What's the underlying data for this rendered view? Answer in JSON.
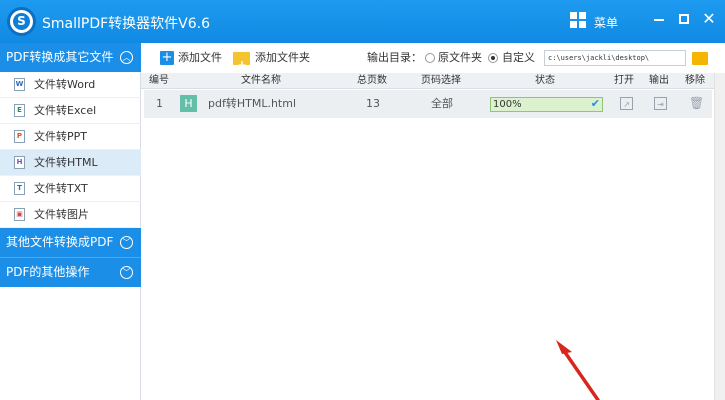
{
  "app": {
    "title": "SmallPDF转换器软件V6.6",
    "logo_letter": "S",
    "menu_label": "菜单"
  },
  "sidebar": {
    "groups": [
      {
        "label": "PDF转换成其它文件",
        "expanded": true,
        "items": [
          {
            "label": "文件转Word",
            "icon": "W"
          },
          {
            "label": "文件转Excel",
            "icon": "E"
          },
          {
            "label": "文件转PPT",
            "icon": "P"
          },
          {
            "label": "文件转HTML",
            "icon": "H",
            "active": true
          },
          {
            "label": "文件转TXT",
            "icon": "T"
          },
          {
            "label": "文件转图片",
            "icon": "▣"
          }
        ]
      },
      {
        "label": "其他文件转换成PDF",
        "expanded": false
      },
      {
        "label": "PDF的其他操作",
        "expanded": false
      }
    ]
  },
  "toolbar": {
    "add_file": "添加文件",
    "add_folder": "添加文件夹",
    "output_label": "输出目录：",
    "option_original": "原文件夹",
    "option_custom": "自定义",
    "selected_option": "custom",
    "output_path": "c:\\users\\jackli\\desktop\\"
  },
  "table": {
    "headers": [
      "编号",
      "文件名称",
      "总页数",
      "页码选择",
      "状态",
      "打开",
      "输出",
      "移除"
    ],
    "rows": [
      {
        "index": "1",
        "file_type_letter": "H",
        "file_name": "pdf转HTML.html",
        "pages": "13",
        "page_selection": "全部",
        "status": "100%",
        "progress": 1.0
      }
    ]
  },
  "colors": {
    "titlebar": "#1a94ee",
    "sidebar_header": "#1b8fe8",
    "active_item": "#dcebf8",
    "progress_fill": "#dcf2cf",
    "arrow": "#d9261c"
  },
  "icons": {
    "menu": "grid-icon",
    "minimize": "minimize-icon",
    "maximize": "maximize-icon",
    "close": "close-icon",
    "open": "open-external-icon",
    "export": "export-icon",
    "delete": "trash-icon",
    "annotation": "red-arrow"
  }
}
